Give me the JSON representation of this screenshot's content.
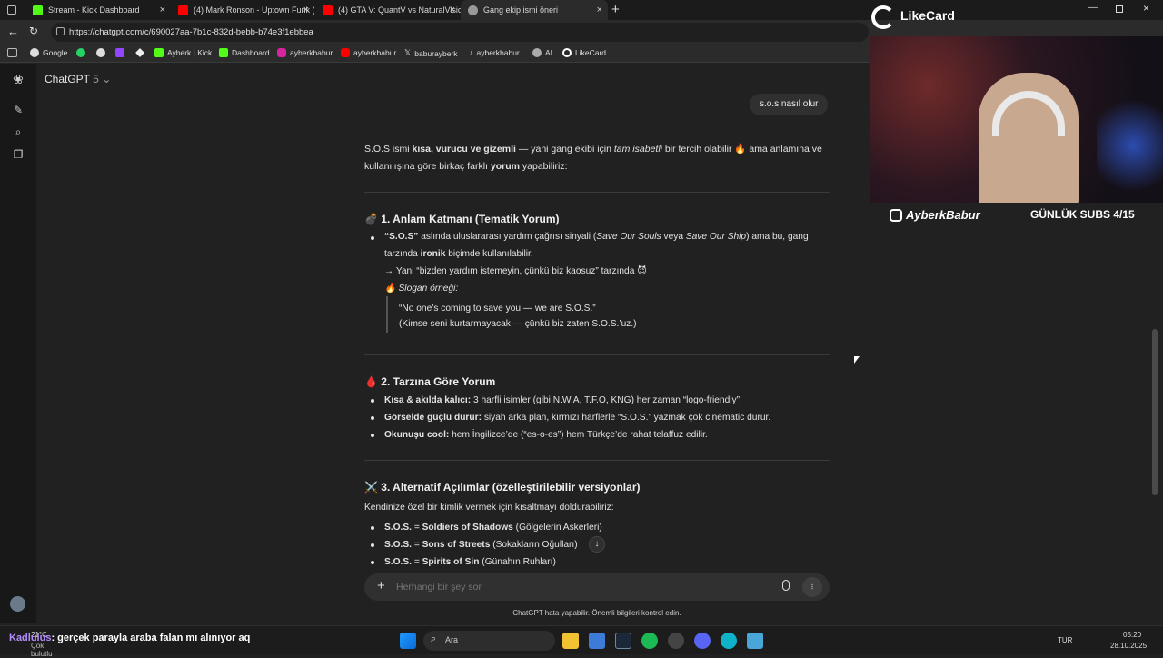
{
  "tabs": [
    {
      "label": "Stream - Kick Dashboard",
      "color": "#53fc18"
    },
    {
      "label": "(4) Mark Ronson - Uptown Funk (",
      "color": "#ff0000"
    },
    {
      "label": "(4) GTA V: QuantV vs NaturalVisio",
      "color": "#ff0000"
    },
    {
      "label": "Gang ekip ismi öneri",
      "color": "#9a9a9a"
    }
  ],
  "address": "https://chatgpt.com/c/690027aa-7b1c-832d-bebb-b74e3f1ebbea",
  "bookmarks": [
    "Google",
    "Ayberk | Kick",
    "Dashboard",
    "ayberkbabur",
    "ayberkbabur",
    "baburayberk",
    "ayberkbabur",
    "AI",
    "LikeCard"
  ],
  "model": {
    "name": "ChatGPT",
    "version": "5"
  },
  "user_message": "s.o.s nasıl olur",
  "intro": {
    "a": "S.O.S ismi ",
    "b": "kısa, vurucu ve gizemli",
    "c": " — yani gang ekibi için ",
    "d": "tam isabetli",
    "e": " bir tercih olabilir 🔥 ama anlamına ve",
    "line2a": "kullanılışına göre birkaç farklı ",
    "line2b": "yorum",
    "line2c": " yapabiliriz:"
  },
  "section1": {
    "title": "💣 1. Anlam Katmanı (Tematik Yorum)",
    "l1a": "“S.O.S”",
    "l1b": " aslında uluslararası yardım çağrısı sinyali (",
    "l1c": "Save Our Souls",
    "l1d": " veya ",
    "l1e": "Save Our Ship",
    "l1f": ") ama bu, gang",
    "l2a": "tarzında ",
    "l2b": "ironik",
    "l2c": " biçimde kullanılabilir.",
    "l3": "→ Yani “bizden yardım istemeyin, çünkü biz kaosuz” tarzında 😈",
    "l4": "🔥 Slogan örneği:",
    "q1": "“No one’s coming to save you — we are S.O.S.”",
    "q2": "(Kimse seni kurtarmayacak — çünkü biz zaten S.O.S.’uz.)"
  },
  "section2": {
    "title": "🩸 2. Tarzına Göre Yorum",
    "items": [
      {
        "b": "Kısa & akılda kalıcı:",
        "t": " 3 harfli isimler (gibi N.W.A, T.F.O, KNG) her zaman “logo-friendly”."
      },
      {
        "b": "Görselde güçlü durur:",
        "t": " siyah arka plan, kırmızı harflerle “S.O.S.” yazmak çok cinematic durur."
      },
      {
        "b": "Okunuşu cool:",
        "t": " hem İngilizce’de (“es-o-es”) hem Türkçe’de rahat telaffuz edilir."
      }
    ]
  },
  "section3": {
    "title": "⚔️ 3. Alternatif Açılımlar (özelleştirilebilir versiyonlar)",
    "intro": "Kendinize özel bir kimlik vermek için kısaltmayı doldurabiliriz:",
    "items": [
      {
        "a": "S.O.S.",
        "b": "Soldiers of Shadows",
        "c": " (Gölgelerin Askerleri)"
      },
      {
        "a": "S.O.S.",
        "b": "Sons of Streets",
        "c": " (Sokakların Oğulları)"
      },
      {
        "a": "S.O.S.",
        "b": "Spirits of Sin",
        "c": " (Günahın Ruhları)"
      }
    ]
  },
  "composer": {
    "placeholder": "Herhangi bir şey sor"
  },
  "disclaimer": "ChatGPT hata yapabilir. Önemli bilgileri kontrol edin.",
  "overlay": {
    "logo": "LikeCard",
    "handle": "AyberkBabur",
    "subs": "GÜNLÜK SUBS 4/15"
  },
  "chat_overlay": {
    "user": "Kadlulus",
    "message": ": gerçek parayla araba falan mı alınıyor aq"
  },
  "taskbar": {
    "weather": "21°C",
    "weather_desc": "Çok bulutlu",
    "search": "Ara",
    "lang": "TUR",
    "time": "05:20",
    "date": "28.10.2025"
  }
}
